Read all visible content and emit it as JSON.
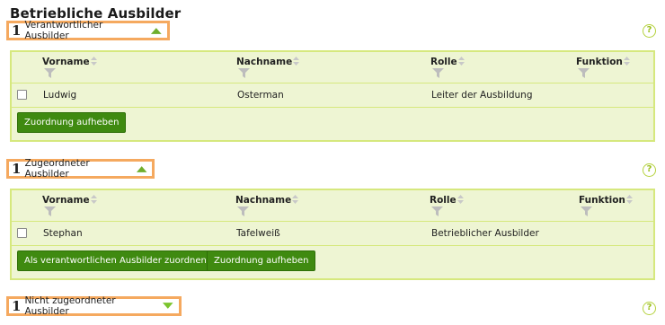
{
  "title": "Betriebliche Ausbilder",
  "colors": {
    "accent_border": "#f5a95f",
    "grid_border": "#d6e87e",
    "grid_bg": "#eef5d3",
    "button": "#3f8a10",
    "toggle_icon": "#6fae2c"
  },
  "columns": [
    "Vorname",
    "Nachname",
    "Rolle",
    "Funktion"
  ],
  "sections": [
    {
      "count": "1",
      "label": "Verantwortlicher Ausbilder",
      "toggle_icon": "chevron-up-icon",
      "rows": [
        {
          "vorname": "Ludwig",
          "nachname": "Osterman",
          "rolle": "Leiter der Ausbildung",
          "funktion": ""
        }
      ],
      "buttons": [
        "Zuordnung aufheben"
      ]
    },
    {
      "count": "1",
      "label": "Zugeordneter Ausbilder",
      "toggle_icon": "chevron-up-icon",
      "rows": [
        {
          "vorname": "Stephan",
          "nachname": "Tafelweiß",
          "rolle": "Betrieblicher Ausbilder",
          "funktion": ""
        }
      ],
      "buttons": [
        "Als verantwortlichen Ausbilder zuordnen",
        "Zuordnung aufheben"
      ]
    },
    {
      "count": "1",
      "label": "Nicht zugeordneter Ausbilder",
      "toggle_icon": "chevron-down-icon"
    }
  ],
  "help_label": "?"
}
